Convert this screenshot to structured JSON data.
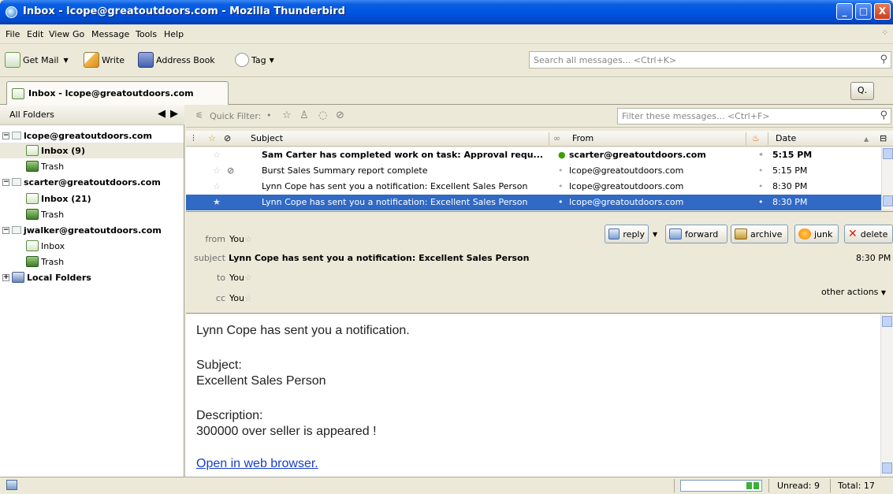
{
  "window": {
    "title": "Inbox - lcope@greatoutdoors.com - Mozilla Thunderbird",
    "minimize": "_",
    "maximize": "□",
    "close": "X"
  },
  "menu": [
    "File",
    "Edit",
    "View",
    "Go",
    "Message",
    "Tools",
    "Help"
  ],
  "toolbar": {
    "get_mail": "Get Mail",
    "write": "Write",
    "address_book": "Address Book",
    "tag": "Tag",
    "search_placeholder": "Search all messages... <Ctrl+K>"
  },
  "tab": {
    "label": "Inbox - lcope@greatoutdoors.com",
    "search_btn": "Q."
  },
  "folders": {
    "header": "All Folders",
    "items": [
      {
        "label": "lcope@greatoutdoors.com"
      },
      {
        "label": "Inbox (9)"
      },
      {
        "label": "Trash"
      },
      {
        "label": "scarter@greatoutdoors.com"
      },
      {
        "label": "Inbox (21)"
      },
      {
        "label": "Trash"
      },
      {
        "label": "jwalker@greatoutdoors.com"
      },
      {
        "label": "Inbox"
      },
      {
        "label": "Trash"
      },
      {
        "label": "Local Folders"
      }
    ]
  },
  "quickfilter": {
    "label": "Quick Filter:",
    "placeholder": "Filter these messages... <Ctrl+F>"
  },
  "thread": {
    "columns": {
      "subject": "Subject",
      "from": "From",
      "date": "Date"
    },
    "rows": [
      {
        "subject": "Sam Carter has completed work on task: Approval requ...",
        "from": "scarter@greatoutdoors.com",
        "date": "5:15 PM"
      },
      {
        "subject": "Burst Sales Summary report complete",
        "from": "lcope@greatoutdoors.com",
        "date": "5:15 PM"
      },
      {
        "subject": "Lynn Cope has sent you a notification: Excellent Sales Person",
        "from": "lcope@greatoutdoors.com",
        "date": "8:30 PM"
      },
      {
        "subject": "Lynn Cope has sent you a notification: Excellent Sales Person",
        "from": "lcope@greatoutdoors.com",
        "date": "8:30 PM"
      }
    ]
  },
  "message": {
    "from_label": "from",
    "from": "You",
    "subject_label": "subject",
    "subject": "Lynn Cope has sent you a notification: Excellent Sales Person",
    "to_label": "to",
    "to": "You",
    "cc_label": "cc",
    "cc": "You",
    "time": "8:30 PM",
    "other_actions": "other actions",
    "actions": {
      "reply": "reply",
      "forward": "forward",
      "archive": "archive",
      "junk": "junk",
      "delete": "delete"
    },
    "body": {
      "line1": "Lynn Cope has sent you a notification.",
      "subject_label": "Subject:",
      "subject_value": "Excellent Sales Person",
      "desc_label": "Description:",
      "desc_value": "300000 over seller is appeared !",
      "link": "Open in web browser."
    }
  },
  "status": {
    "unread": "Unread: 9",
    "total": "Total: 17"
  }
}
